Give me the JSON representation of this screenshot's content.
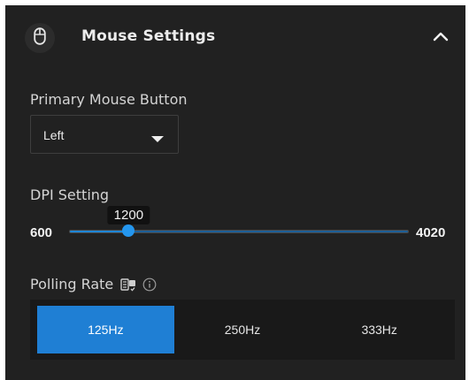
{
  "header": {
    "title": "Mouse Settings",
    "icon": "mouse-icon",
    "collapse_icon": "chevron-up-icon"
  },
  "primary_button": {
    "label": "Primary Mouse Button",
    "value": "Left"
  },
  "dpi": {
    "label": "DPI Setting",
    "min": "600",
    "max": "4020",
    "value": "1200",
    "min_value": 600,
    "max_value": 4020,
    "current_value": 1200
  },
  "polling": {
    "label": "Polling Rate",
    "icons": [
      "device-sync-icon",
      "info-icon"
    ],
    "options": [
      "125Hz",
      "250Hz",
      "333Hz"
    ],
    "selected": "125Hz"
  },
  "colors": {
    "accent": "#1f7fd4",
    "panel_bg": "#212121"
  }
}
